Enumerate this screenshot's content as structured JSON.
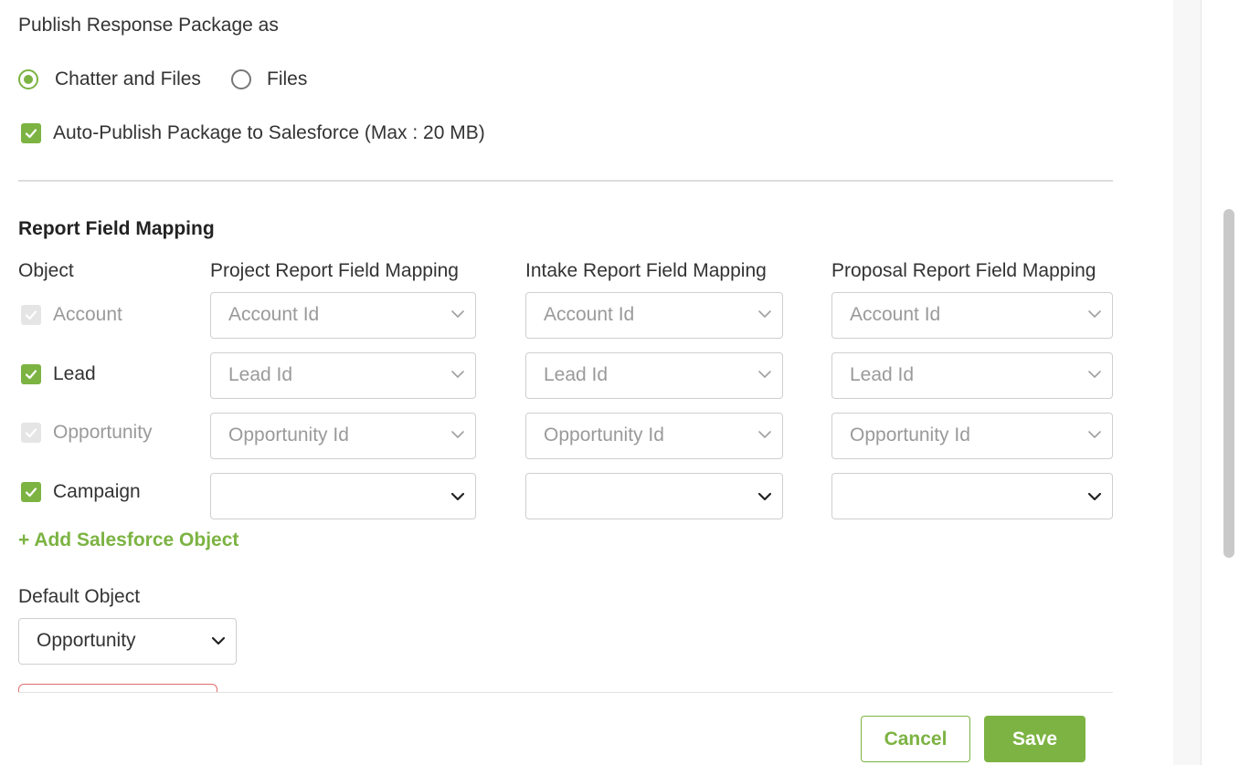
{
  "publish": {
    "heading": "Publish Response Package as",
    "options": [
      {
        "label": "Chatter and Files",
        "checked": true
      },
      {
        "label": "Files",
        "checked": false
      }
    ],
    "auto_publish_label": "Auto-Publish Package to Salesforce (Max : 20 MB)",
    "auto_publish_checked": true
  },
  "mapping": {
    "title": "Report Field Mapping",
    "headers": {
      "object": "Object",
      "project": "Project Report Field Mapping",
      "intake": "Intake Report Field Mapping",
      "proposal": "Proposal Report Field Mapping"
    },
    "rows": [
      {
        "object": "Account",
        "checked": true,
        "disabled": true,
        "project": "Account Id",
        "intake": "Account Id",
        "proposal": "Account Id"
      },
      {
        "object": "Lead",
        "checked": true,
        "disabled": false,
        "project": "Lead Id",
        "intake": "Lead Id",
        "proposal": "Lead Id"
      },
      {
        "object": "Opportunity",
        "checked": true,
        "disabled": true,
        "project": "Opportunity Id",
        "intake": "Opportunity Id",
        "proposal": "Opportunity Id"
      },
      {
        "object": "Campaign",
        "checked": true,
        "disabled": false,
        "project": "",
        "intake": "",
        "proposal": ""
      }
    ],
    "add_object_label": "+ Add Salesforce Object"
  },
  "default_object": {
    "label": "Default Object",
    "value": "Opportunity"
  },
  "footer": {
    "cancel_label": "Cancel",
    "save_label": "Save"
  },
  "colors": {
    "accent": "#7cb342",
    "muted_text": "#9a9a9a",
    "border": "#cfcfcf"
  }
}
